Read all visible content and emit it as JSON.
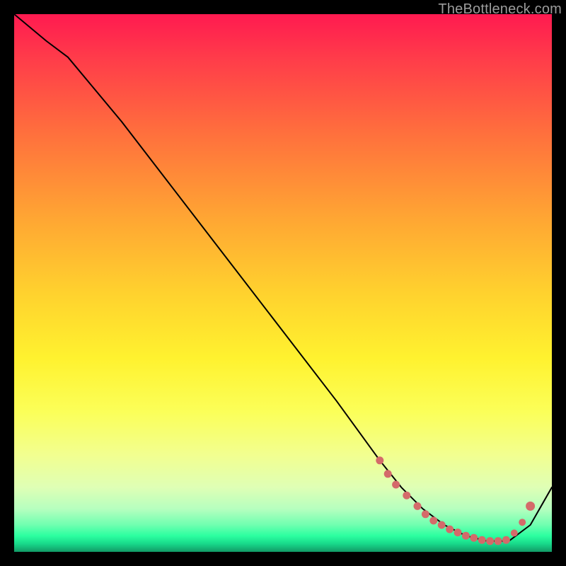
{
  "watermark": "TheBottleneck.com",
  "gradient_colors": {
    "top": "#ff1a50",
    "mid_upper": "#ffa633",
    "mid": "#fff22f",
    "mid_lower": "#dfffb5",
    "bottom": "#129a66"
  },
  "marker_color": "#d46a6a",
  "line_color": "#000000",
  "chart_data": {
    "type": "line",
    "title": "",
    "xlabel": "",
    "ylabel": "",
    "xlim": [
      0,
      100
    ],
    "ylim": [
      0,
      100
    ],
    "grid": false,
    "legend": false,
    "series": [
      {
        "name": "curve",
        "x": [
          0,
          6,
          10,
          20,
          30,
          40,
          50,
          60,
          68,
          72,
          76,
          80,
          84,
          88,
          92,
          96,
          100
        ],
        "y": [
          100,
          95,
          92,
          80,
          67,
          54,
          41,
          28,
          17,
          12,
          8,
          5,
          3,
          2,
          2,
          5,
          12
        ]
      }
    ],
    "markers": [
      {
        "x": 68.0,
        "y": 17.0
      },
      {
        "x": 69.5,
        "y": 14.5
      },
      {
        "x": 71.0,
        "y": 12.5
      },
      {
        "x": 73.0,
        "y": 10.5
      },
      {
        "x": 75.0,
        "y": 8.5
      },
      {
        "x": 76.5,
        "y": 7.0
      },
      {
        "x": 78.0,
        "y": 5.8
      },
      {
        "x": 79.5,
        "y": 5.0
      },
      {
        "x": 81.0,
        "y": 4.2
      },
      {
        "x": 82.5,
        "y": 3.6
      },
      {
        "x": 84.0,
        "y": 3.0
      },
      {
        "x": 85.5,
        "y": 2.6
      },
      {
        "x": 87.0,
        "y": 2.2
      },
      {
        "x": 88.5,
        "y": 2.0
      },
      {
        "x": 90.0,
        "y": 2.0
      },
      {
        "x": 91.5,
        "y": 2.2
      },
      {
        "x": 93.0,
        "y": 3.5
      },
      {
        "x": 94.5,
        "y": 5.5
      },
      {
        "x": 96.0,
        "y": 8.5
      }
    ]
  }
}
